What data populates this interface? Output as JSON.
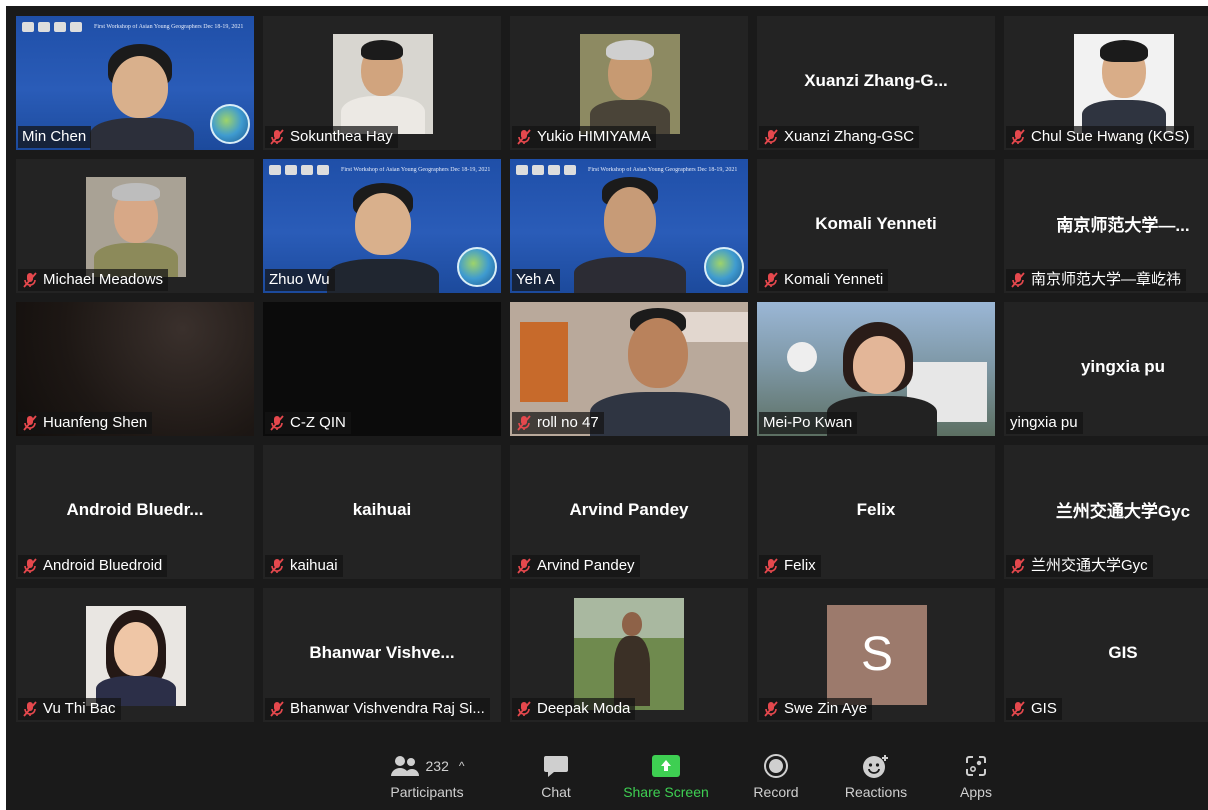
{
  "participants_grid": [
    {
      "display_name": "Min Chen",
      "big_name": "",
      "muted": false,
      "kind": "slide"
    },
    {
      "display_name": "Sokunthea Hay",
      "big_name": "",
      "muted": true,
      "kind": "photo"
    },
    {
      "display_name": "Yukio HIMIYAMA",
      "big_name": "",
      "muted": true,
      "kind": "photo"
    },
    {
      "display_name": "Xuanzi Zhang-GSC",
      "big_name": "Xuanzi  Zhang-G...",
      "muted": true,
      "kind": "name"
    },
    {
      "display_name": "Chul Sue Hwang (KGS)",
      "big_name": "",
      "muted": true,
      "kind": "photo"
    },
    {
      "display_name": "Michael Meadows",
      "big_name": "",
      "muted": true,
      "kind": "photo"
    },
    {
      "display_name": "Zhuo Wu",
      "big_name": "",
      "muted": false,
      "kind": "slide"
    },
    {
      "display_name": "Yeh A",
      "big_name": "",
      "muted": false,
      "kind": "slide"
    },
    {
      "display_name": "Komali Yenneti",
      "big_name": "Komali Yenneti",
      "muted": true,
      "kind": "name"
    },
    {
      "display_name": "南京师范大学—章屹祎",
      "big_name": "南京师范大学—...",
      "muted": true,
      "kind": "name"
    },
    {
      "display_name": "Huanfeng Shen",
      "big_name": "",
      "muted": true,
      "kind": "dark"
    },
    {
      "display_name": "C-Z QIN",
      "big_name": "",
      "muted": true,
      "kind": "black"
    },
    {
      "display_name": "roll no 47",
      "big_name": "",
      "muted": true,
      "kind": "photo"
    },
    {
      "display_name": "Mei-Po Kwan",
      "big_name": "",
      "muted": false,
      "kind": "photo"
    },
    {
      "display_name": "yingxia pu",
      "big_name": "yingxia pu",
      "muted": false,
      "kind": "name"
    },
    {
      "display_name": "Android Bluedroid",
      "big_name": "Android  Bluedr...",
      "muted": true,
      "kind": "name"
    },
    {
      "display_name": "kaihuai",
      "big_name": "kaihuai",
      "muted": true,
      "kind": "name"
    },
    {
      "display_name": "Arvind Pandey",
      "big_name": "Arvind Pandey",
      "muted": true,
      "kind": "name"
    },
    {
      "display_name": "Felix",
      "big_name": "Felix",
      "muted": true,
      "kind": "name"
    },
    {
      "display_name": "兰州交通大学Gyc",
      "big_name": "兰州交通大学Gyc",
      "muted": true,
      "kind": "name"
    },
    {
      "display_name": "Vu Thi Bac",
      "big_name": "",
      "muted": true,
      "kind": "photo"
    },
    {
      "display_name": "Bhanwar Vishvendra Raj Si...",
      "big_name": "Bhanwar  Vishve...",
      "muted": true,
      "kind": "name"
    },
    {
      "display_name": "Deepak Moda",
      "big_name": "",
      "muted": true,
      "kind": "photo"
    },
    {
      "display_name": "Swe Zin Aye",
      "big_name": "",
      "muted": true,
      "kind": "avatar",
      "avatar_letter": "S",
      "avatar_color": "#9c7a6c"
    },
    {
      "display_name": "GIS",
      "big_name": "GIS",
      "muted": true,
      "kind": "name"
    }
  ],
  "slide_text": "First Workshop of Asian Young Geographers  Dec 18-19, 2021",
  "toolbar": {
    "participants_label": "Participants",
    "participants_count": "232",
    "chat_label": "Chat",
    "share_label": "Share Screen",
    "record_label": "Record",
    "reactions_label": "Reactions",
    "apps_label": "Apps"
  },
  "colors": {
    "active_speaker_border": "#c7e27a",
    "muted_mic": "#e5484d",
    "share_green": "#3ecf52",
    "background": "#1a1a1a",
    "tile": "#232323"
  }
}
